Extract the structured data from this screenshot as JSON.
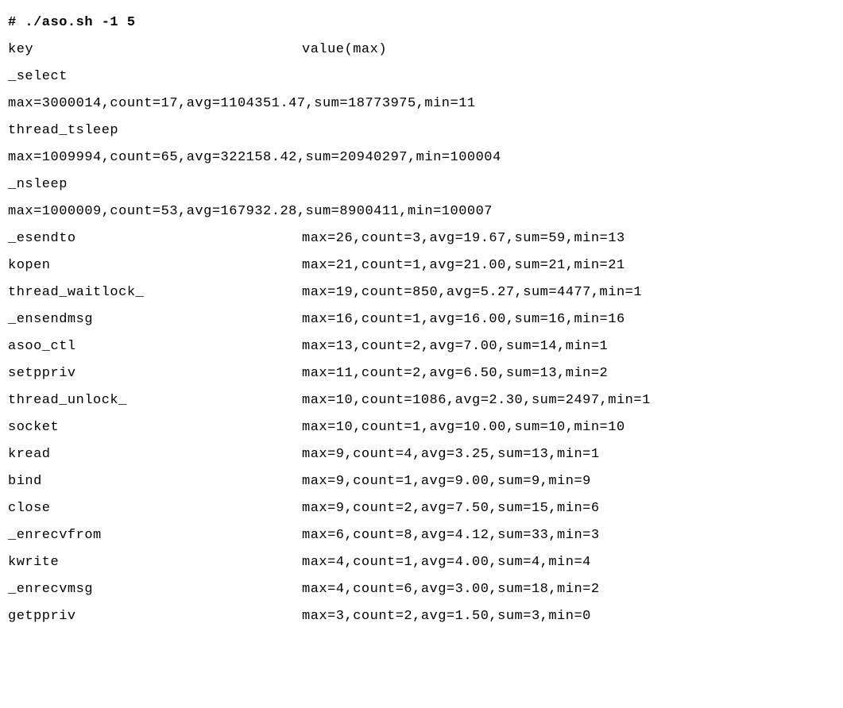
{
  "command": "# ./aso.sh -1 5",
  "header": {
    "key": "key",
    "value": "value(max)"
  },
  "multiline_entries": [
    {
      "key": "_select",
      "value": "max=3000014,count=17,avg=1104351.47,sum=18773975,min=11"
    },
    {
      "key": "thread_tsleep",
      "value": "max=1009994,count=65,avg=322158.42,sum=20940297,min=100004"
    },
    {
      "key": "_nsleep",
      "value": "max=1000009,count=53,avg=167932.28,sum=8900411,min=100007"
    }
  ],
  "inline_entries": [
    {
      "key": "_esendto",
      "value": "max=26,count=3,avg=19.67,sum=59,min=13"
    },
    {
      "key": "kopen",
      "value": "max=21,count=1,avg=21.00,sum=21,min=21"
    },
    {
      "key": "thread_waitlock_",
      "value": "max=19,count=850,avg=5.27,sum=4477,min=1"
    },
    {
      "key": "_ensendmsg",
      "value": "max=16,count=1,avg=16.00,sum=16,min=16"
    },
    {
      "key": "asoo_ctl",
      "value": "max=13,count=2,avg=7.00,sum=14,min=1"
    },
    {
      "key": "setppriv",
      "value": "max=11,count=2,avg=6.50,sum=13,min=2"
    },
    {
      "key": "thread_unlock_",
      "value": "max=10,count=1086,avg=2.30,sum=2497,min=1"
    },
    {
      "key": "socket",
      "value": "max=10,count=1,avg=10.00,sum=10,min=10"
    },
    {
      "key": "kread",
      "value": "max=9,count=4,avg=3.25,sum=13,min=1"
    },
    {
      "key": "bind",
      "value": "max=9,count=1,avg=9.00,sum=9,min=9"
    },
    {
      "key": "close",
      "value": "max=9,count=2,avg=7.50,sum=15,min=6"
    },
    {
      "key": "_enrecvfrom",
      "value": "max=6,count=8,avg=4.12,sum=33,min=3"
    },
    {
      "key": "kwrite",
      "value": "max=4,count=1,avg=4.00,sum=4,min=4"
    },
    {
      "key": "_enrecvmsg",
      "value": "max=4,count=6,avg=3.00,sum=18,min=2"
    },
    {
      "key": "getppriv",
      "value": "max=3,count=2,avg=1.50,sum=3,min=0"
    }
  ]
}
